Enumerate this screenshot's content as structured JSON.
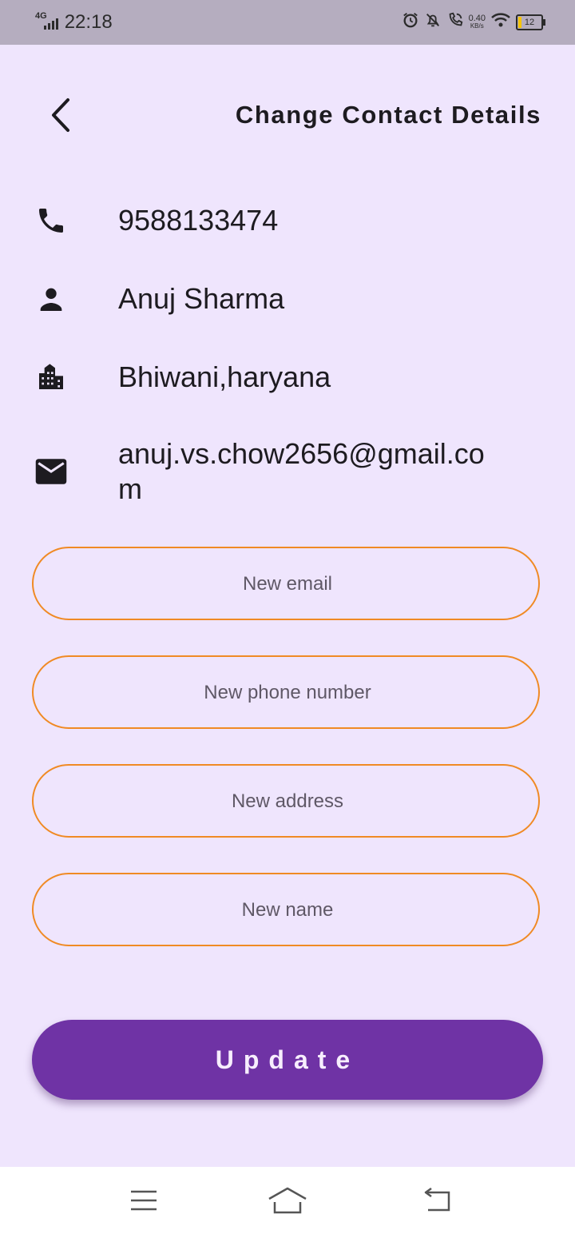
{
  "status_bar": {
    "network": "4G",
    "time": "22:18",
    "data_rate_value": "0.40",
    "data_rate_unit": "KB/s",
    "battery": "12",
    "icons": [
      "alarm-icon",
      "notifications-off-icon",
      "wifi-calling-icon",
      "wifi-icon",
      "battery-icon"
    ]
  },
  "header": {
    "back_icon": "chevron-left-icon",
    "title": "Change Contact Details"
  },
  "contact": {
    "phone": "9588133474",
    "name": "Anuj Sharma",
    "address": "Bhiwani,haryana",
    "email": "anuj.vs.chow2656@gmail.com"
  },
  "form": {
    "email_placeholder": "New email",
    "phone_placeholder": "New phone number",
    "address_placeholder": "New address",
    "name_placeholder": "New name",
    "update_label": "Update"
  },
  "colors": {
    "background": "#efe5fd",
    "field_border": "#f08a24",
    "button": "#6f33a5",
    "status_bar": "#b5adbf"
  },
  "nav_bar": {
    "icons": [
      "menu-icon",
      "home-icon",
      "back-icon"
    ]
  }
}
